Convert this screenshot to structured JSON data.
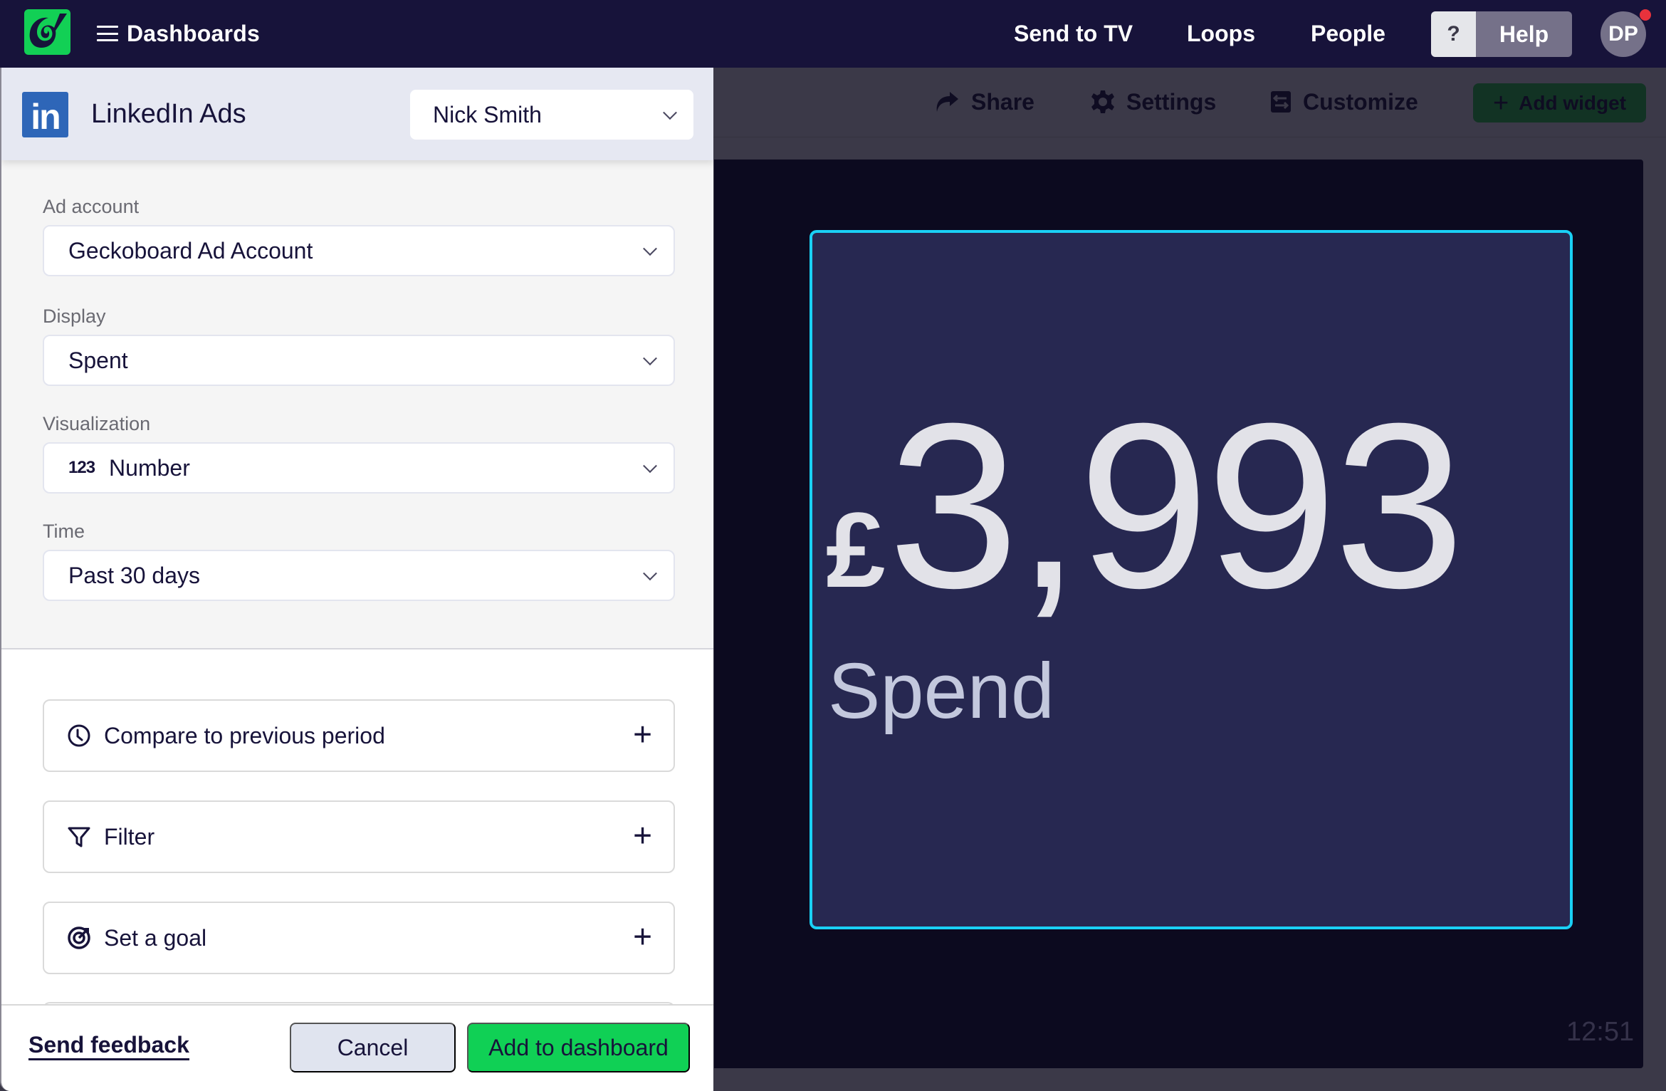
{
  "topnav": {
    "logo": "geckoboard-logo",
    "menu_label": "Dashboards",
    "links": [
      "Send to TV",
      "Loops",
      "People"
    ],
    "help_icon_label": "?",
    "help_label": "Help",
    "avatar_initials": "DP",
    "notification": true
  },
  "toolbar": {
    "share_label": "Share",
    "settings_label": "Settings",
    "customize_label": "Customize",
    "add_widget_label": "Add widget",
    "add_widget_icon": "+"
  },
  "widget": {
    "currency": "£",
    "value": "3,993",
    "label": "Spend",
    "border_color": "#1ad0f5",
    "background_color": "#272851"
  },
  "canvas": {
    "clock": "12:51"
  },
  "panel": {
    "integration_logo": "in",
    "title": "LinkedIn Ads",
    "account": "Nick Smith",
    "fields": [
      {
        "label": "Ad account",
        "value": "Geckoboard Ad Account"
      },
      {
        "label": "Display",
        "value": "Spent"
      },
      {
        "label": "Visualization",
        "value": "Number",
        "icon_text": "123"
      },
      {
        "label": "Time",
        "value": "Past 30 days"
      }
    ],
    "options": [
      {
        "label": "Compare to previous period",
        "icon": "clock-icon"
      },
      {
        "label": "Filter",
        "icon": "filter-icon"
      },
      {
        "label": "Set a goal",
        "icon": "goal-icon"
      }
    ],
    "plus_symbol": "+",
    "footer": {
      "feedback_label": "Send feedback",
      "cancel_label": "Cancel",
      "add_label": "Add to dashboard"
    }
  },
  "colors": {
    "nav_bg": "#17133a",
    "brand_green": "#10d055",
    "linkedin_blue": "#2e66b8",
    "accent_cyan": "#1ad0f5",
    "notification_red": "#e8323c"
  }
}
